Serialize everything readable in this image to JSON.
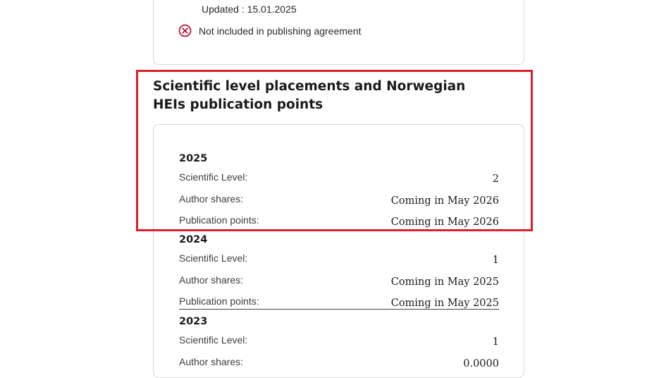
{
  "journal_info": {
    "updated_text": "Updated : 15.01.2025",
    "publishing_status": "Not included in publishing agreement",
    "status_icon": "x-circle-icon",
    "status_color": "#b5153a"
  },
  "section": {
    "title": "Scientific level placements and Norwegian HEIs publication points"
  },
  "years": [
    {
      "year": "2025",
      "rows": [
        {
          "label": "Scientific Level:",
          "value": "2"
        },
        {
          "label": "Author shares:",
          "value": "Coming in May 2026"
        },
        {
          "label": "Publication points:",
          "value": "Coming in May 2026"
        }
      ]
    },
    {
      "year": "2024",
      "rows": [
        {
          "label": "Scientific Level:",
          "value": "1"
        },
        {
          "label": "Author shares:",
          "value": "Coming in May 2025"
        },
        {
          "label": "Publication points:",
          "value": "Coming in May 2025"
        }
      ]
    },
    {
      "year": "2023",
      "rows": [
        {
          "label": "Scientific Level:",
          "value": "1"
        },
        {
          "label": "Author shares:",
          "value": "0.0000"
        }
      ]
    }
  ],
  "highlight_color": "#d9202b"
}
